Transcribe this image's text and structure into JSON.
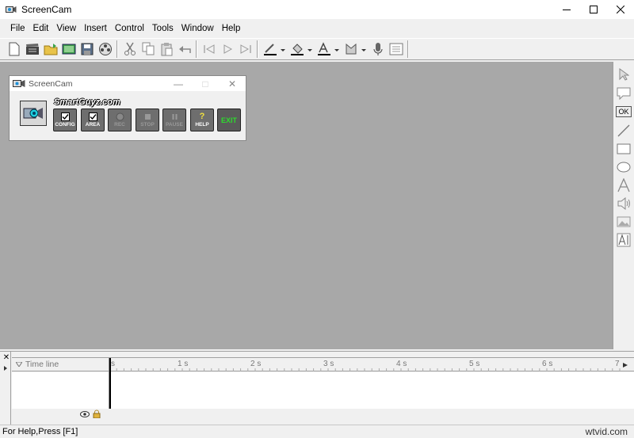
{
  "window": {
    "title": "ScreenCam"
  },
  "menu": {
    "items": [
      {
        "label": "File"
      },
      {
        "label": "Edit"
      },
      {
        "label": "View"
      },
      {
        "label": "Insert"
      },
      {
        "label": "Control"
      },
      {
        "label": "Tools"
      },
      {
        "label": "Window"
      },
      {
        "label": "Help"
      }
    ]
  },
  "child_window": {
    "title": "ScreenCam",
    "brand": "SmartGuyz.com",
    "buttons": [
      {
        "label": "CONFIG"
      },
      {
        "label": "AREA"
      },
      {
        "label": "REC"
      },
      {
        "label": "STOP"
      },
      {
        "label": "PAUSE"
      },
      {
        "label": "HELP"
      },
      {
        "label": "EXIT"
      }
    ]
  },
  "palette": {
    "ok_label": "OK"
  },
  "timeline": {
    "label": "Time line",
    "ticks": [
      "s",
      "1 s",
      "2 s",
      "3 s",
      "4 s",
      "5 s",
      "6 s",
      "7"
    ]
  },
  "status": {
    "text": "For Help,Press [F1]"
  },
  "watermark": "wtvid.com"
}
